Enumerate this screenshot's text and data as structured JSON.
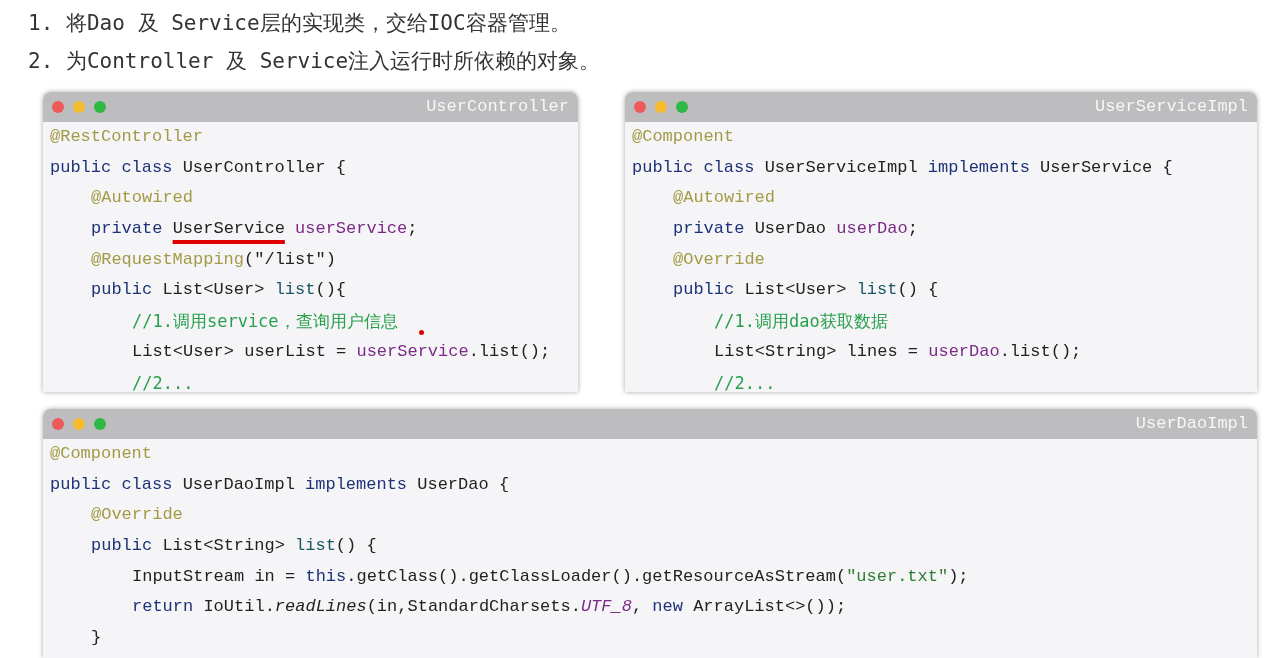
{
  "instructions": [
    "1. 将Dao 及 Service层的实现类，交给IOC容器管理。",
    "2. 为Controller 及 Service注入运行时所依赖的对象。"
  ],
  "code_windows": [
    {
      "title": "UserController",
      "pointer_dot": true,
      "lines": [
        {
          "tokens": [
            {
              "kind": "annotation",
              "text": "@RestController"
            }
          ]
        },
        {
          "tokens": [
            {
              "kind": "keyword",
              "text": "public class "
            },
            {
              "kind": "plain",
              "text": "UserController {"
            }
          ],
          "children": [
            {
              "tokens": [
                {
                  "kind": "annotation",
                  "text": "@Autowired"
                }
              ]
            },
            {
              "tokens": [
                {
                  "kind": "keyword",
                  "text": "private "
                },
                {
                  "kind": "underlined",
                  "text": "UserService"
                },
                {
                  "kind": "field",
                  "text": " userService"
                },
                {
                  "kind": "plain",
                  "text": ";"
                }
              ]
            },
            {
              "tokens": [
                {
                  "kind": "annotation",
                  "text": "@RequestMapping"
                },
                {
                  "kind": "plain",
                  "text": "(\"/list\")"
                }
              ]
            },
            {
              "tokens": [
                {
                  "kind": "keyword",
                  "text": "public "
                },
                {
                  "kind": "plain",
                  "text": "List<User> "
                },
                {
                  "kind": "method",
                  "text": "list"
                },
                {
                  "kind": "plain",
                  "text": "(){"
                }
              ],
              "children": [
                {
                  "tokens": [
                    {
                      "kind": "comment",
                      "text": "//1.调用service，查询用户信息"
                    }
                  ]
                },
                {
                  "tokens": [
                    {
                      "kind": "plain",
                      "text": "List<User> userList = "
                    },
                    {
                      "kind": "field",
                      "text": "userService"
                    },
                    {
                      "kind": "plain",
                      "text": ".list();"
                    }
                  ]
                },
                {
                  "tokens": [
                    {
                      "kind": "comment",
                      "text": "//2..."
                    }
                  ]
                }
              ]
            }
          ]
        }
      ]
    },
    {
      "title": "UserServiceImpl",
      "pointer_dot": false,
      "lines": [
        {
          "tokens": [
            {
              "kind": "annotation",
              "text": "@Component"
            }
          ]
        },
        {
          "tokens": [
            {
              "kind": "keyword",
              "text": "public class "
            },
            {
              "kind": "plain",
              "text": "UserServiceImpl "
            },
            {
              "kind": "keyword",
              "text": "implements "
            },
            {
              "kind": "plain",
              "text": "UserService {"
            }
          ],
          "children": [
            {
              "tokens": [
                {
                  "kind": "annotation",
                  "text": "@Autowired"
                }
              ]
            },
            {
              "tokens": [
                {
                  "kind": "keyword",
                  "text": "private "
                },
                {
                  "kind": "plain",
                  "text": "UserDao "
                },
                {
                  "kind": "field",
                  "text": "userDao"
                },
                {
                  "kind": "plain",
                  "text": ";"
                }
              ]
            },
            {
              "tokens": [
                {
                  "kind": "annotation",
                  "text": "@Override"
                }
              ]
            },
            {
              "tokens": [
                {
                  "kind": "keyword",
                  "text": "public "
                },
                {
                  "kind": "plain",
                  "text": "List<User> "
                },
                {
                  "kind": "method",
                  "text": "list"
                },
                {
                  "kind": "plain",
                  "text": "() {"
                }
              ],
              "children": [
                {
                  "tokens": [
                    {
                      "kind": "comment",
                      "text": "//1.调用dao获取数据"
                    }
                  ]
                },
                {
                  "tokens": [
                    {
                      "kind": "plain",
                      "text": "List<String> lines = "
                    },
                    {
                      "kind": "field",
                      "text": "userDao"
                    },
                    {
                      "kind": "plain",
                      "text": ".list();"
                    }
                  ]
                },
                {
                  "tokens": [
                    {
                      "kind": "comment",
                      "text": "//2..."
                    }
                  ]
                }
              ]
            }
          ]
        }
      ]
    },
    {
      "title": "UserDaoImpl",
      "pointer_dot": false,
      "lines": [
        {
          "tokens": [
            {
              "kind": "annotation",
              "text": "@Component"
            }
          ]
        },
        {
          "tokens": [
            {
              "kind": "keyword",
              "text": "public class "
            },
            {
              "kind": "plain",
              "text": "UserDaoImpl "
            },
            {
              "kind": "keyword",
              "text": "implements "
            },
            {
              "kind": "plain",
              "text": "UserDao {"
            }
          ],
          "children": [
            {
              "tokens": [
                {
                  "kind": "annotation",
                  "text": "@Override"
                }
              ]
            },
            {
              "tokens": [
                {
                  "kind": "keyword",
                  "text": "public "
                },
                {
                  "kind": "plain",
                  "text": "List<String> "
                },
                {
                  "kind": "method",
                  "text": "list"
                },
                {
                  "kind": "plain",
                  "text": "() {"
                }
              ],
              "children": [
                {
                  "tokens": [
                    {
                      "kind": "plain",
                      "text": "InputStream in = "
                    },
                    {
                      "kind": "keyword",
                      "text": "this"
                    },
                    {
                      "kind": "plain",
                      "text": ".getClass().getClassLoader().getResourceAsStream("
                    },
                    {
                      "kind": "string",
                      "text": "\"user.txt\""
                    },
                    {
                      "kind": "plain",
                      "text": ");"
                    }
                  ]
                },
                {
                  "tokens": [
                    {
                      "kind": "keyword",
                      "text": "return "
                    },
                    {
                      "kind": "plain",
                      "text": "IoUtil."
                    },
                    {
                      "kind": "italic",
                      "text": "readLines"
                    },
                    {
                      "kind": "plain",
                      "text": "(in,StandardCharsets."
                    },
                    {
                      "kind": "constant",
                      "text": "UTF_8"
                    },
                    {
                      "kind": "plain",
                      "text": ", "
                    },
                    {
                      "kind": "keyword",
                      "text": "new "
                    },
                    {
                      "kind": "plain",
                      "text": "ArrayList<>());"
                    }
                  ]
                }
              ]
            },
            {
              "tokens": [
                {
                  "kind": "plain",
                  "text": "}"
                }
              ]
            }
          ]
        }
      ]
    }
  ]
}
